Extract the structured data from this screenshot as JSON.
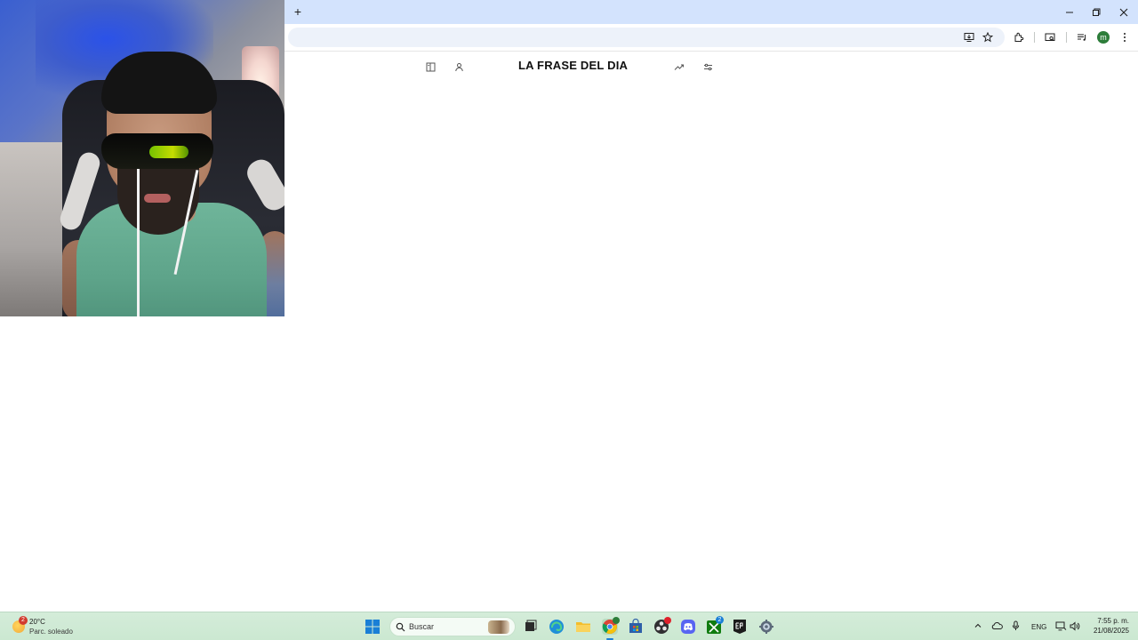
{
  "webcam": {
    "alt": "webcam-feed"
  },
  "browser": {
    "new_tab_label": "+",
    "profile_initial": "m"
  },
  "page": {
    "title": "LA FRASE DEL DIA"
  },
  "taskbar": {
    "weather_temp": "20°C",
    "weather_condition": "Parc. soleado",
    "weather_badge": "2",
    "search_label": "Buscar",
    "language": "ENG",
    "time": "7:55 p. m.",
    "date": "21/08/2025",
    "xbox_badge": "2"
  },
  "colors": {
    "tabstrip": "#d3e3fd",
    "omnibox": "#edf2fa",
    "taskbar": "#cbe8d1",
    "avatar": "#2d7d3a"
  },
  "icons": {
    "toolbar": [
      "install-app-icon",
      "star-icon",
      "extensions-icon",
      "tab-search-icon",
      "media-icon",
      "profile-avatar",
      "kebab-menu-icon"
    ],
    "window": [
      "minimize-icon",
      "restore-icon",
      "close-icon"
    ],
    "page_header": [
      "sidebar-icon",
      "person-icon",
      "trending-icon",
      "settings-sliders-icon"
    ],
    "taskbar": [
      "start-icon",
      "search-icon",
      "task-view-icon",
      "edge-icon",
      "file-explorer-icon",
      "chrome-icon",
      "store-icon",
      "obs-icon",
      "discord-icon",
      "xbox-icon",
      "epic-games-icon",
      "settings-icon"
    ]
  }
}
